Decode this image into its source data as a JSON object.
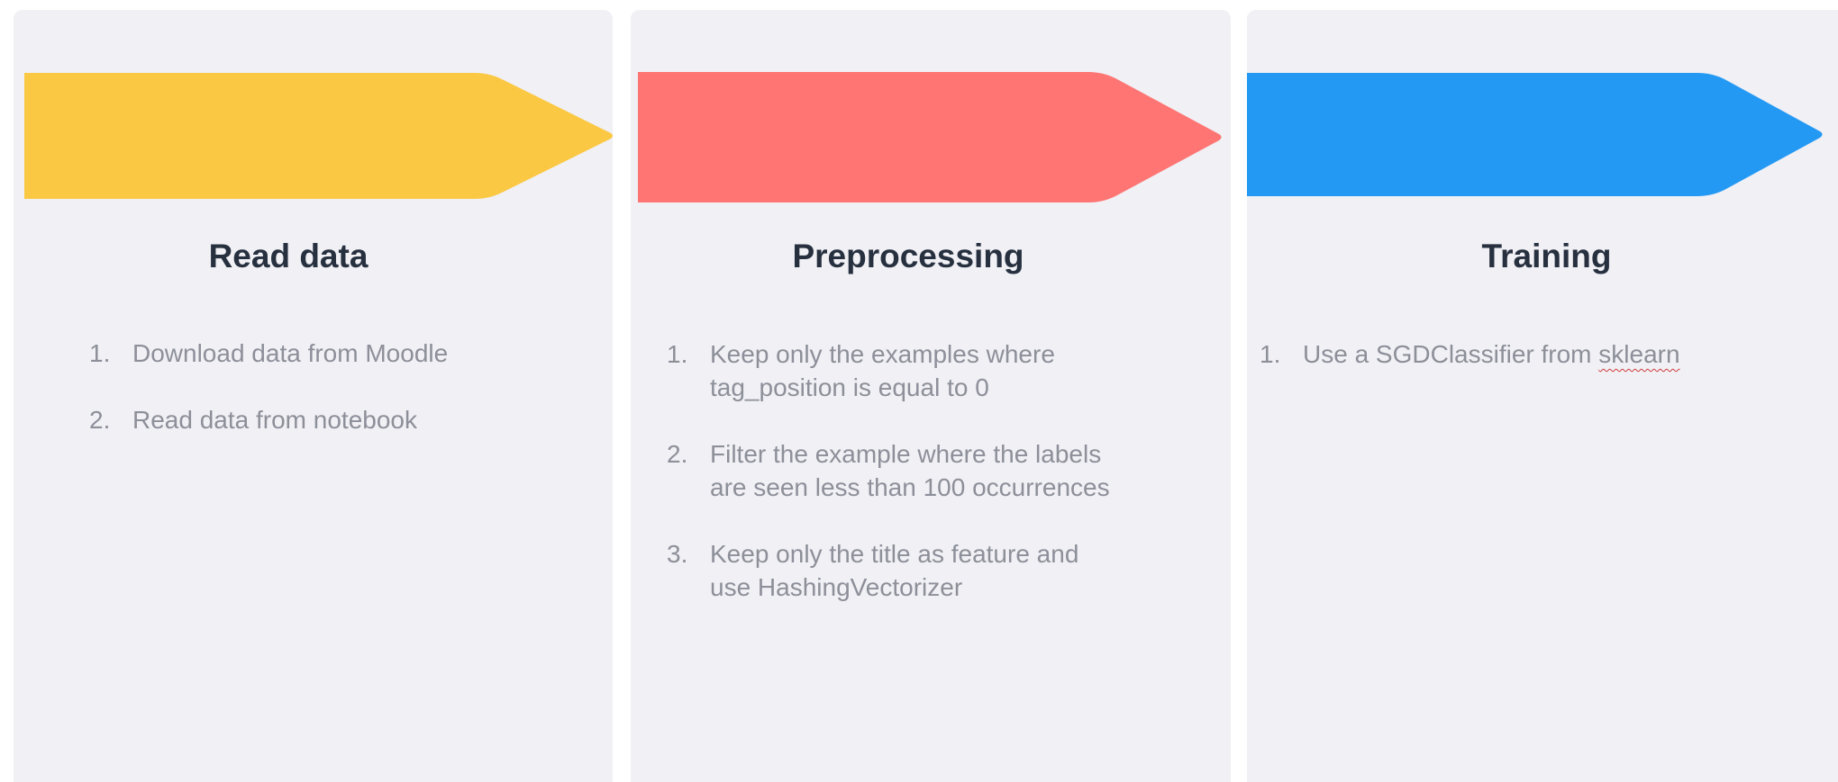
{
  "steps": [
    {
      "title": "Read data",
      "color": "#fbc843",
      "items": [
        {
          "num": "1.",
          "text": "Download data from Moodle"
        },
        {
          "num": "2.",
          "text": "Read data from notebook"
        }
      ]
    },
    {
      "title": "Preprocessing",
      "color": "#fe7573",
      "items": [
        {
          "num": "1.",
          "line1": "Keep only the examples where",
          "line2": "tag_position is equal to 0"
        },
        {
          "num": "2.",
          "line1": "Filter the example where the labels",
          "line2": "are seen less than 100 occurrences"
        },
        {
          "num": "3.",
          "line1": "Keep only the title as feature and",
          "line2": "use HashingVectorizer"
        }
      ]
    },
    {
      "title": "Training",
      "color": "#2499f3",
      "items": [
        {
          "num": "1.",
          "text": "Use a SGDClassifier from",
          "flagged_word": "sklearn"
        }
      ]
    }
  ]
}
